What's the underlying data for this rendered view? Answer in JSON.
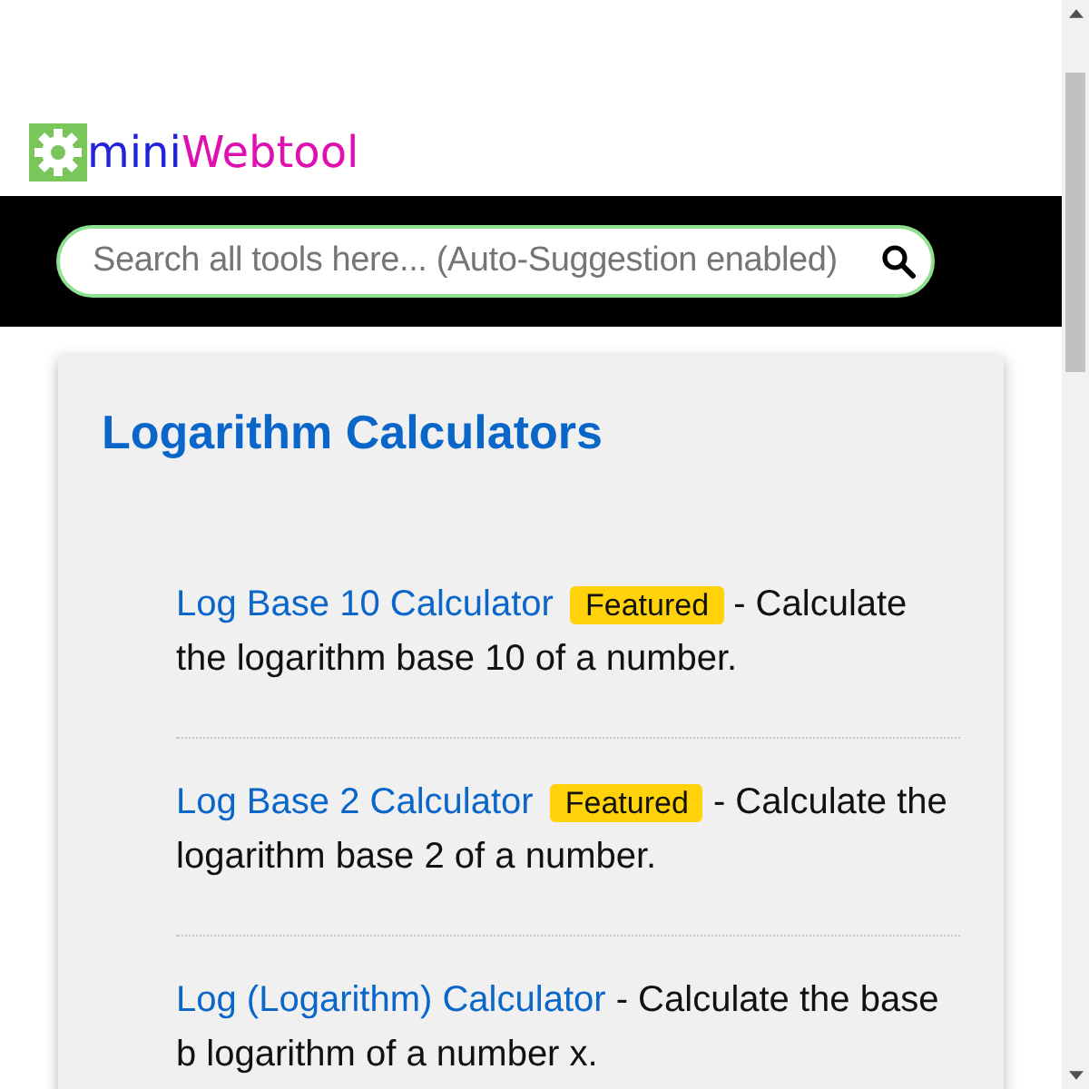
{
  "logo": {
    "part_1": "mini",
    "part_2": "Webtool"
  },
  "search": {
    "placeholder": "Search all tools here... (Auto-Suggestion enabled)"
  },
  "section": {
    "title": "Logarithm Calculators",
    "items": [
      {
        "link": "Log Base 10 Calculator",
        "badge": "Featured",
        "description": "- Calculate the logarithm base 10 of a number."
      },
      {
        "link": "Log Base 2 Calculator",
        "badge": "Featured",
        "description": "- Calculate the logarithm base 2 of a number."
      },
      {
        "link": "Log (Logarithm) Calculator",
        "description": "- Calculate the base b logarithm of a number x."
      }
    ]
  }
}
